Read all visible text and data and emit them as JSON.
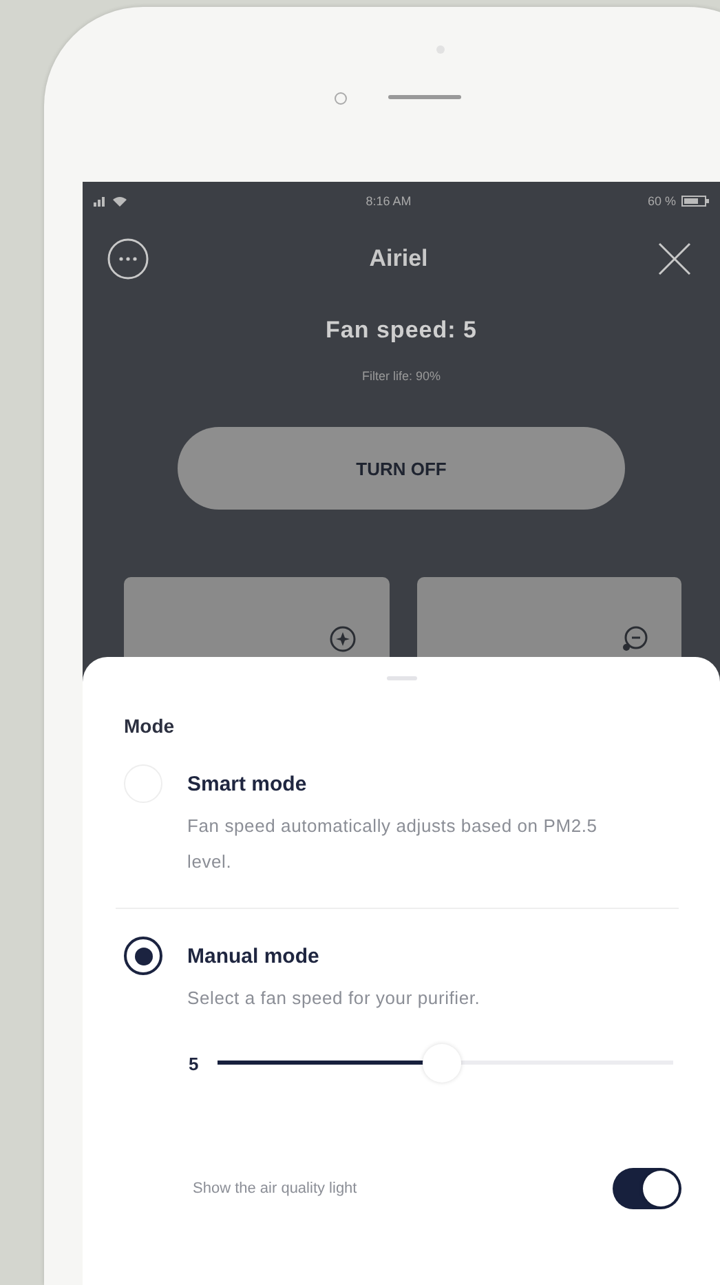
{
  "status_bar": {
    "time": "8:16 AM",
    "battery": "60 %"
  },
  "header": {
    "title": "Airiel"
  },
  "fan_speed": "Fan speed: 5",
  "filter_life": "Filter life: 90%",
  "power_button": "TURN OFF",
  "sheet": {
    "title": "Mode",
    "modes": [
      {
        "name": "Smart mode",
        "description": "Fan speed automatically adjusts based on PM2.5 level.",
        "selected": false
      },
      {
        "name": "Manual mode",
        "description": "Select a fan speed for your purifier.",
        "selected": true
      }
    ],
    "speed": {
      "value": "5",
      "level": 0.49
    },
    "light_toggle": {
      "label": "Show the air quality light",
      "on": true
    }
  }
}
